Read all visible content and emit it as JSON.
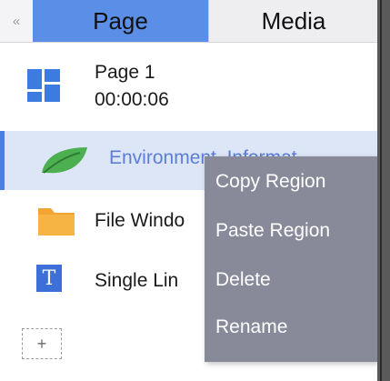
{
  "header": {
    "collapse_glyph": "«",
    "tabs": [
      {
        "label": "Page"
      },
      {
        "label": "Media"
      }
    ]
  },
  "items": [
    {
      "icon": "page-layout-icon",
      "label": "Page 1",
      "sub": "00:00:06"
    },
    {
      "icon": "leaf-icon",
      "label": "Environment_Informat"
    },
    {
      "icon": "folder-icon",
      "label": "File Windo"
    },
    {
      "icon": "text-icon",
      "label": "Single Lin"
    }
  ],
  "add_button": {
    "label": "+"
  },
  "context_menu": {
    "items": [
      {
        "label": "Copy Region"
      },
      {
        "label": "Paste Region"
      },
      {
        "label": "Delete"
      },
      {
        "label": "Rename"
      }
    ]
  },
  "colors": {
    "accent": "#5b8ee6",
    "selected_bg": "#dde6f7",
    "menu_bg": "#888a9a",
    "leaf": "#4caf50",
    "folder": "#f3a534",
    "text_icon": "#3d6fd9"
  }
}
